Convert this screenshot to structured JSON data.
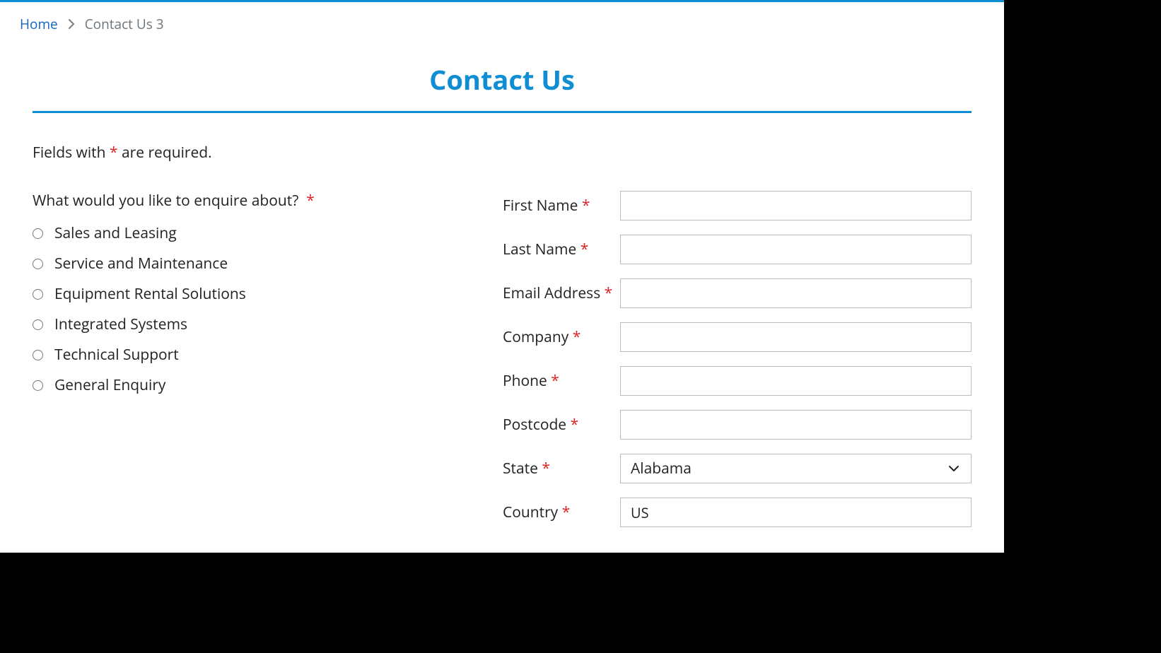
{
  "breadcrumb": {
    "home": "Home",
    "current": "Contact Us 3"
  },
  "title": "Contact Us",
  "required_note_pre": "Fields with ",
  "required_note_post": " are required.",
  "asterisk": "*",
  "enquire": {
    "label": "What would you like to enquire about?",
    "options": [
      "Sales and Leasing",
      "Service and Maintenance",
      "Equipment Rental Solutions",
      "Integrated Systems",
      "Technical Support",
      "General Enquiry"
    ]
  },
  "fields": {
    "first_name": {
      "label": "First Name",
      "value": ""
    },
    "last_name": {
      "label": "Last Name",
      "value": ""
    },
    "email": {
      "label": "Email Address",
      "value": ""
    },
    "company": {
      "label": "Company",
      "value": ""
    },
    "phone": {
      "label": "Phone",
      "value": ""
    },
    "postcode": {
      "label": "Postcode",
      "value": ""
    },
    "state": {
      "label": "State",
      "selected": "Alabama"
    },
    "country": {
      "label": "Country",
      "value": "US"
    }
  }
}
